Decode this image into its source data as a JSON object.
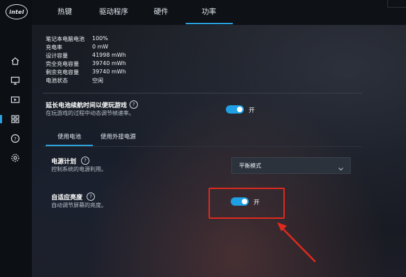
{
  "app": {
    "logo_text": "intel"
  },
  "tabs": [
    {
      "label": "热键"
    },
    {
      "label": "驱动程序"
    },
    {
      "label": "硬件"
    },
    {
      "label": "功率",
      "active": true
    }
  ],
  "sidebar": {
    "icons": [
      "home-icon",
      "display-icon",
      "video-icon",
      "apps-grid-icon",
      "help-icon",
      "settings-gear-icon"
    ]
  },
  "battery_status": {
    "rows": [
      {
        "label": "笔记本电脑电池",
        "value": "100%"
      },
      {
        "label": "充电率",
        "value": "0 mW"
      },
      {
        "label": "设计容量",
        "value": "41998 mWh"
      },
      {
        "label": "完全充电容量",
        "value": "39740 mWh"
      },
      {
        "label": "剩余充电容量",
        "value": "39740 mWh"
      },
      {
        "label": "电池状态",
        "value": "空闲"
      }
    ]
  },
  "extend_battery": {
    "title": "延长电池续航时间以便玩游戏",
    "help": "?",
    "description": "在玩游戏的过程中动态调节帧速率。",
    "toggle_label": "开",
    "toggle_on": true
  },
  "power_tabs": [
    {
      "label": "使用电池",
      "active": true
    },
    {
      "label": "使用外接电源"
    }
  ],
  "power_plan": {
    "title": "电源计划",
    "help": "?",
    "description": "控制系统的电源利用。",
    "selected": "平衡模式"
  },
  "adaptive_brightness": {
    "title": "自适应亮度",
    "help": "?",
    "description": "自动调节屏幕的亮度。",
    "toggle_label": "开",
    "toggle_on": true
  },
  "colors": {
    "accent": "#1fa0e4",
    "highlight": "#e02a1f"
  }
}
